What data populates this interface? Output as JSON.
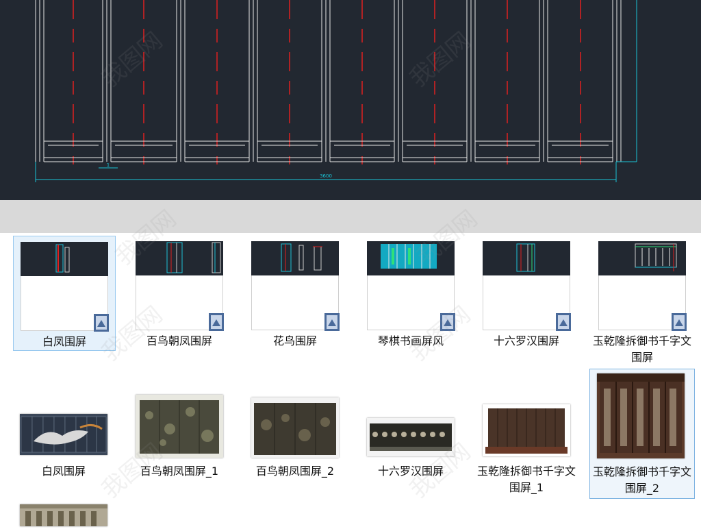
{
  "cad_view": {
    "dimension_small": "1",
    "dimension_total": "3600"
  },
  "files": [
    {
      "label": "白凤围屏",
      "kind": "dwg"
    },
    {
      "label": "百鸟朝凤围屏",
      "kind": "dwg"
    },
    {
      "label": "花鸟围屏",
      "kind": "dwg"
    },
    {
      "label": "琴棋书画屏风",
      "kind": "dwg"
    },
    {
      "label": "十六罗汉围屏",
      "kind": "dwg"
    },
    {
      "label": "玉乾隆拆御书千字文围屏",
      "kind": "dwg"
    },
    {
      "label": "白凤围屏",
      "kind": "image"
    },
    {
      "label": "百鸟朝凤围屏_1",
      "kind": "image"
    },
    {
      "label": "百鸟朝凤围屏_2",
      "kind": "image"
    },
    {
      "label": "十六罗汉围屏",
      "kind": "image"
    },
    {
      "label": "玉乾隆拆御书千字文围屏_1",
      "kind": "image"
    },
    {
      "label": "玉乾隆拆御书千字文围屏_2",
      "kind": "image"
    },
    {
      "label": "",
      "kind": "image"
    }
  ],
  "watermark": "我图网",
  "colors": {
    "cad_background": "#222831",
    "cad_lines": "#e8e8e8",
    "cad_red": "#e02020",
    "cad_cyan": "#19c4d8",
    "selection": "#e5f1fb"
  }
}
